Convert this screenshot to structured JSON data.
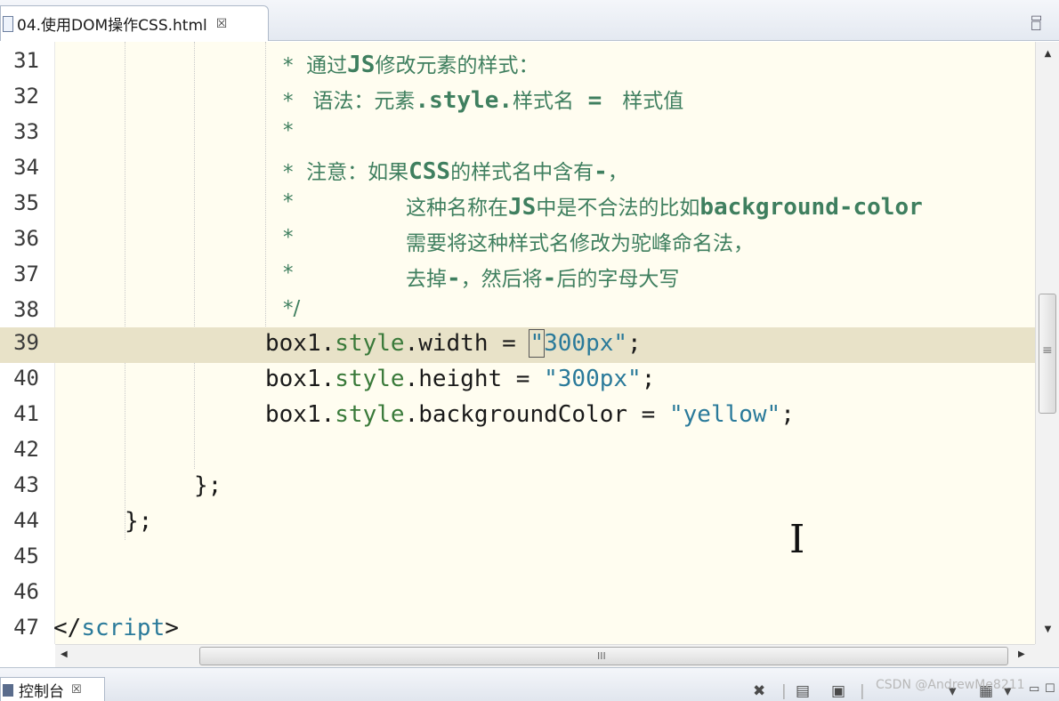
{
  "tab": {
    "title": "04.使用DOM操作CSS.html",
    "close": "☒"
  },
  "view_controls": {
    "minimize": "▭",
    "maximize": "☐"
  },
  "lines": [
    {
      "n": "31",
      "indent": "",
      "star": "* ",
      "text": "通过",
      "bold": "JS",
      "rest": "修改元素的样式："
    },
    {
      "n": "32",
      "text": "*   语法：元素"
    },
    {
      "n": "33",
      "text": "*"
    },
    {
      "n": "34",
      "text": "*  注意：如果"
    },
    {
      "n": "35",
      "text": "*"
    },
    {
      "n": "36",
      "text": "*"
    },
    {
      "n": "37",
      "text": "*"
    },
    {
      "n": "38",
      "text": "*/"
    },
    {
      "n": "39"
    },
    {
      "n": "40"
    },
    {
      "n": "41"
    },
    {
      "n": "42"
    },
    {
      "n": "43"
    },
    {
      "n": "44"
    },
    {
      "n": "45"
    },
    {
      "n": "46"
    },
    {
      "n": "47"
    }
  ],
  "comment": {
    "l31_a": "*  通过",
    "l31_b": "JS",
    "l31_c": "修改元素的样式：",
    "l32_a": "*   语法：元素",
    "l32_b": ".style.",
    "l32_c": "样式名",
    "l32_d": " = ",
    "l32_e": " 样式值",
    "l33": "*",
    "l34_a": "*  注意：如果",
    "l34_b": "CSS",
    "l34_c": "的样式名中含有",
    "l34_d": "-",
    "l34_e": "，",
    "l35_a": "*",
    "l35_b": "这种名称在",
    "l35_c": "JS",
    "l35_d": "中是不合法的比如",
    "l35_e": "background-color",
    "l36_a": "*",
    "l36_b": "需要将这种样式名修改为驼峰命名法，",
    "l37_a": "*",
    "l37_b": "去掉",
    "l37_c": "-",
    "l37_d": "，然后将",
    "l37_e": "-",
    "l37_f": "后的字母大写",
    "l38": "*/"
  },
  "code": {
    "l39_obj": "box1.",
    "l39_prop": "style",
    "l39_dot": ".width = ",
    "l39_q1": "\"",
    "l39_val": "300px",
    "l39_q2": "\"",
    "l39_end": ";",
    "l40_obj": "box1.",
    "l40_prop": "style",
    "l40_dot": ".height = ",
    "l40_str": "\"300px\"",
    "l40_end": ";",
    "l41_obj": "box1.",
    "l41_prop": "style",
    "l41_dot": ".backgroundColor = ",
    "l41_str": "\"yellow\"",
    "l41_end": ";",
    "l43": "};",
    "l44": "};",
    "l47_a": "</",
    "l47_b": "script",
    "l47_c": ">"
  },
  "scrollbar": {
    "up": "▲",
    "down": "▼",
    "left": "◀",
    "right": "▶",
    "hgrip": "III",
    "vgrip": "≡"
  },
  "console": {
    "label": "控制台",
    "close": "☒"
  },
  "toolbar": {
    "remove": "✖",
    "sep": "|",
    "pin": "▤",
    "display": "▣",
    "menu": "▾",
    "open": "▦",
    "minimize": "▭",
    "maximize": "☐"
  },
  "watermark": "CSDN @AndrewMe8211",
  "cursor": "I"
}
